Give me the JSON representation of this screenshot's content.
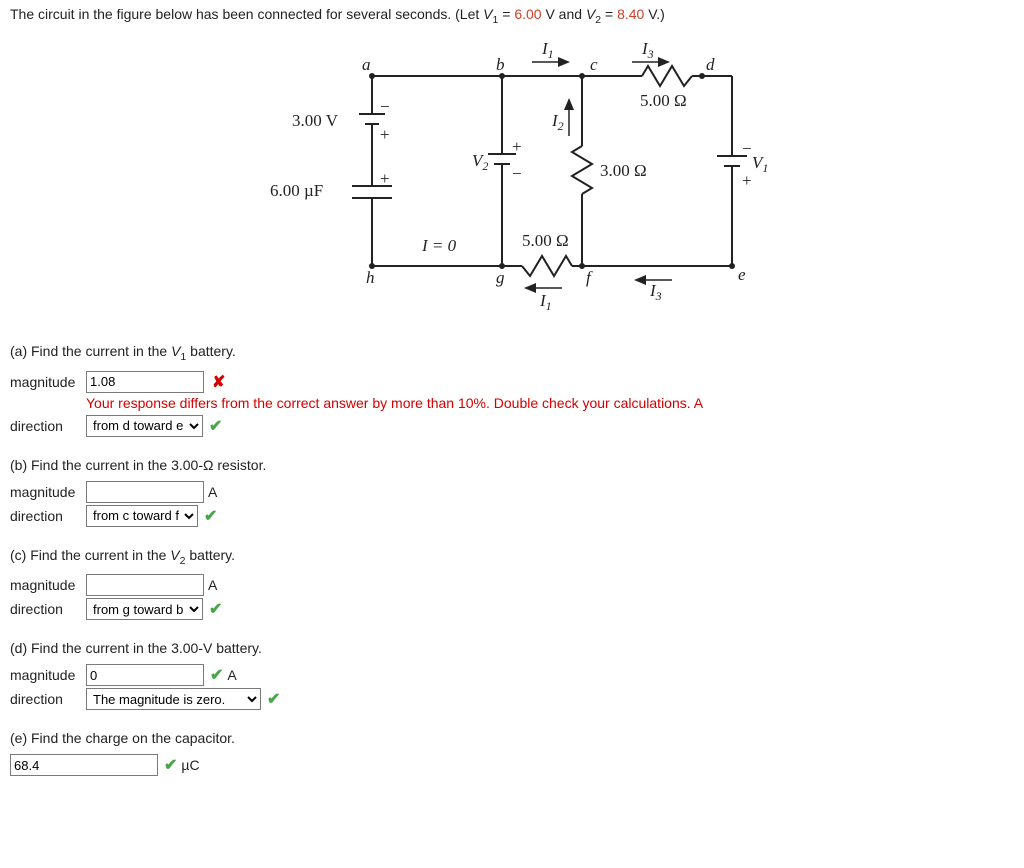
{
  "intro": {
    "prefix": "The circuit in the figure below has been connected for several seconds. (Let ",
    "v1sym": "V",
    "v1sub": "1",
    "eq": " = ",
    "v1val": "6.00",
    "vunit": " V",
    "and": " and ",
    "v2sym": "V",
    "v2sub": "2",
    "v2val": "8.40",
    "suffix": " V.)"
  },
  "circuit": {
    "a": "a",
    "b": "b",
    "c": "c",
    "d": "d",
    "e": "e",
    "f": "f",
    "g": "g",
    "h": "h",
    "r5_top": "5.00 Ω",
    "r3_mid": "3.00 Ω",
    "r5_bot": "5.00 Ω",
    "v3": "3.00 V",
    "c6": "6.00 µF",
    "v1": "V",
    "v1_sub": "1",
    "v2": "V",
    "v2_sub": "2",
    "I1_top": "I",
    "I1_sub": "1",
    "I2_mid": "I",
    "I2_sub": "2",
    "I3_top": "I",
    "I3_sub": "3",
    "I1_bot": "I",
    "I1_bot_sub": "1",
    "I3_bot": "I",
    "I3_bot_sub": "3",
    "Ieq0": "I = 0",
    "plus": "+",
    "minus": "−"
  },
  "parts": {
    "a": {
      "prompt_pre": "(a) Find the current in the ",
      "prompt_sym": "V",
      "prompt_sub": "1",
      "prompt_post": " battery.",
      "mag_label": "magnitude",
      "mag_value": "1.08",
      "feedback": "Your response differs from the correct answer by more than 10%. Double check your calculations. A",
      "dir_label": "direction",
      "dir_value": "from d toward e"
    },
    "b": {
      "prompt": "(b) Find the current in the 3.00-Ω resistor.",
      "mag_label": "magnitude",
      "mag_value": "",
      "unit": "A",
      "dir_label": "direction",
      "dir_value": "from c toward f"
    },
    "c": {
      "prompt_pre": "(c) Find the current in the ",
      "prompt_sym": "V",
      "prompt_sub": "2",
      "prompt_post": " battery.",
      "mag_label": "magnitude",
      "mag_value": "",
      "unit": "A",
      "dir_label": "direction",
      "dir_value": "from g toward b"
    },
    "d": {
      "prompt": "(d) Find the current in the 3.00-V battery.",
      "mag_label": "magnitude",
      "mag_value": "0",
      "unit": "A",
      "dir_label": "direction",
      "dir_value": "The magnitude is zero."
    },
    "e": {
      "prompt": "(e) Find the charge on the capacitor.",
      "value": "68.4",
      "unit": "µC"
    }
  }
}
